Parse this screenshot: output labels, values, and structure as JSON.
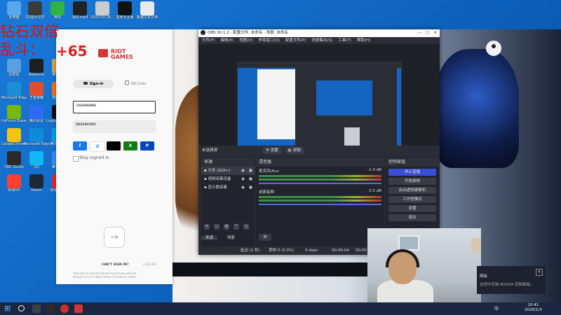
{
  "desktop_icons": [
    {
      "label": "此电脑",
      "color": "#58a8e8"
    },
    {
      "label": "QQ音乐文件",
      "color": "#3b3b3b"
    },
    {
      "label": "微信",
      "color": "#2fb344"
    },
    {
      "label": "录屏.mp4",
      "color": "#222222"
    },
    {
      "label": "2023.02.28...",
      "color": "#cccccc"
    },
    {
      "label": "剪映专业版",
      "color": "#111111"
    },
    {
      "label": "新建文本文档",
      "color": "#e9e9e9"
    },
    {
      "label": "回收站",
      "color": "#5a9fe0"
    },
    {
      "label": "WeGame",
      "color": "#1e1e1e"
    },
    {
      "label": "英雄联盟",
      "color": "#c9a44d"
    },
    {
      "label": "Microsoft Edge",
      "color": "#1a8fd6"
    },
    {
      "label": "王者荣耀",
      "color": "#e24d2d"
    },
    {
      "label": "地图大全",
      "color": "#ff6a00"
    },
    {
      "label": "GeForce Experience",
      "color": "#76b900"
    },
    {
      "label": "腾讯会议",
      "color": "#2b6cf0"
    },
    {
      "label": "Logitech G HUB",
      "color": "#0c0c0c"
    },
    {
      "label": "GoogleChrome",
      "color": "#f1c40f"
    },
    {
      "label": "Microsoft Edge",
      "color": "#0f8ad9"
    },
    {
      "label": "腾讯加速器",
      "color": "#0b9cf0"
    },
    {
      "label": "OBS Studio",
      "color": "#2a2a2a"
    },
    {
      "label": "QQ",
      "color": "#12b7f5"
    },
    {
      "label": "腾讯视频",
      "color": "#3e86f5"
    },
    {
      "label": "网易UU",
      "color": "#ff3f2e"
    },
    {
      "label": "Steam",
      "color": "#1b2838"
    },
    {
      "label": "网易云音乐",
      "color": "#e3262f"
    }
  ],
  "overlay": {
    "line1": "钻石双倍",
    "line2": "乱斗：",
    "score": "+65"
  },
  "riot": {
    "brand_line1": "RIOT",
    "brand_line2": "GAMES",
    "tab_signin": "Sign-in",
    "tab_qr": "QR Code",
    "username_label": "USERNAME",
    "password_label": "PASSWORD",
    "social": [
      {
        "name": "facebook",
        "glyph": "f",
        "color": "#1877f2"
      },
      {
        "name": "google",
        "glyph": "G",
        "color": "#ffffff"
      },
      {
        "name": "apple",
        "glyph": "",
        "color": "#000000"
      },
      {
        "name": "xbox",
        "glyph": "X",
        "color": "#107c10"
      },
      {
        "name": "playstation",
        "glyph": "P",
        "color": "#0046be"
      }
    ],
    "stay_signed_in": "Stay signed in",
    "arrow": "→",
    "cant_sign_in": "CAN'T SIGN IN?",
    "version": "v123.6.1",
    "hcaptcha_line1": "THIS APP IS PROTECTED BY HCAPTCHA AND ITS",
    "hcaptcha_line2": "PRIVACY POLICY AND TERMS OF SERVICE APPLY."
  },
  "obs": {
    "title": "OBS 30.1.2 - 配置文件: 未命名 - 场景: 未命名",
    "menu": [
      "文件(F)",
      "编辑(E)",
      "视图(V)",
      "停靠窗口(D)",
      "配置文件(P)",
      "场景集合(S)",
      "工具(T)",
      "帮助(H)"
    ],
    "no_source_selected": "未选择源",
    "properties_label": "设置",
    "filters_label": "滤镜",
    "sources_header": "来源",
    "sources": [
      "文本 (GDI+)",
      "视频采集设备",
      "显示器采集"
    ],
    "mixer_header": "混音器",
    "mixer": [
      {
        "name": "麦克风/Aux",
        "db": "-1.4 dB"
      },
      {
        "name": "桌面音频",
        "db": "-3.5 dB"
      }
    ],
    "controls_header": "控制按钮",
    "controls": [
      "停止直播",
      "开始录制",
      "启动虚拟摄像机",
      "工作室模式",
      "设置",
      "退出"
    ],
    "tab_sources": "来源",
    "tab_scenes": "场景",
    "status_drop": "延迟 (1 秒)",
    "status_dropped_frames": "丢帧 0 (0.0%)",
    "status_kbps": "0 kbps",
    "status_time": "00:00:04",
    "status_time2": "00:00"
  },
  "webcam": {
    "label": "webcam-feed"
  },
  "notification": {
    "title": "面板",
    "body": "在您中安装 NVIDIA 控制面板。",
    "close": "✕"
  },
  "taskbar": {
    "start_glyph": "⊞",
    "clock_time": "10:41",
    "clock_date": "2026/1/3",
    "tray_lang": "中"
  }
}
